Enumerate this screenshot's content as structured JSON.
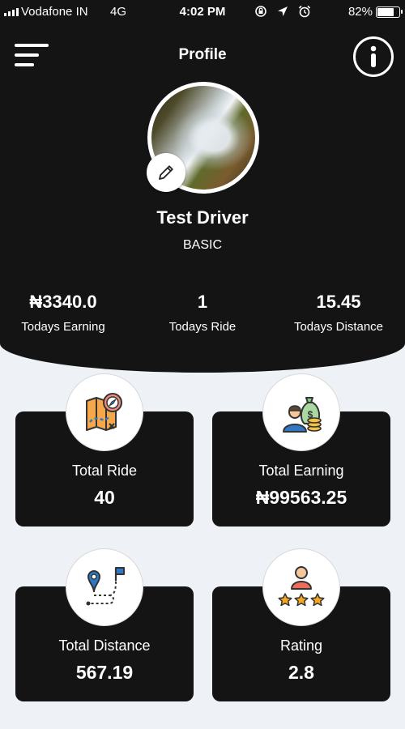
{
  "status_bar": {
    "carrier": "Vodafone IN",
    "network": "4G",
    "time": "4:02 PM",
    "battery_percent": "82%",
    "battery_level": 0.82
  },
  "nav": {
    "title": "Profile",
    "menu_icon": "hamburger-icon",
    "info_icon": "info-icon"
  },
  "profile": {
    "name": "Test Driver",
    "plan": "BASIC"
  },
  "today": [
    {
      "value": "₦3340.0",
      "label": "Todays Earning"
    },
    {
      "value": "1",
      "label": "Todays Ride"
    },
    {
      "value": "15.45",
      "label": "Todays Distance"
    }
  ],
  "cards": [
    {
      "label": "Total Ride",
      "value": "40",
      "icon": "map-compass-icon"
    },
    {
      "label": "Total Earning",
      "value": "₦99563.25",
      "icon": "money-bag-icon"
    },
    {
      "label": "Total Distance",
      "value": "567.19",
      "icon": "route-icon"
    },
    {
      "label": "Rating",
      "value": "2.8",
      "icon": "star-rating-icon"
    }
  ],
  "colors": {
    "dark": "#141414",
    "background": "#eef1f5",
    "accent_blue": "#2f78c4",
    "accent_orange": "#f29b3a"
  }
}
